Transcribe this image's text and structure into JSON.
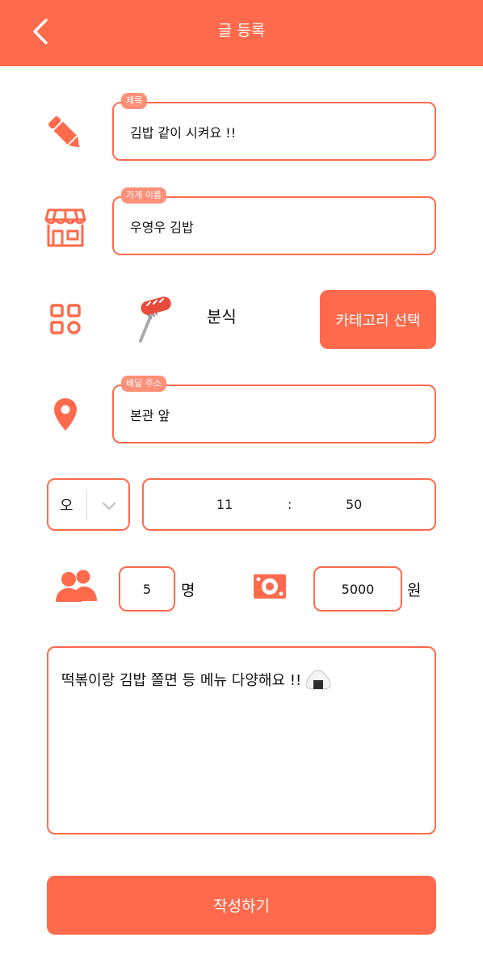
{
  "header": {
    "title": "글 등록"
  },
  "form": {
    "title": {
      "tag": "제목",
      "value": "김밥 같이 시켜요 !!"
    },
    "store": {
      "tag": "가게 이름",
      "value": "우영우 김밥"
    },
    "category": {
      "selected": "분식",
      "button_label": "카테고리 선택"
    },
    "address": {
      "tag": "배달 주소",
      "value": "본관 앞"
    },
    "time": {
      "ampm": "오",
      "hour": "11",
      "separator": ":",
      "minute": "50"
    },
    "people": {
      "count": "5",
      "unit": "명"
    },
    "price": {
      "amount": "5000",
      "unit": "원"
    },
    "memo": {
      "text": "떡볶이랑 김밥 쫄면 등 메뉴 다양해요 !!"
    }
  },
  "submit": {
    "label": "작성하기"
  },
  "icons": {
    "back": "back-arrow-icon",
    "title": "pencil-icon",
    "store": "store-icon",
    "category": "grid-icon",
    "food": "sausage-fork-icon",
    "address": "location-pin-icon",
    "ampm_dropdown": "chevron-down-icon",
    "people": "people-icon",
    "price": "money-icon",
    "memo_emoji": "onigiri-icon"
  },
  "colors": {
    "accent": "#FF6A4C",
    "tag": "#FF9078",
    "white": "#FFFFFF"
  }
}
